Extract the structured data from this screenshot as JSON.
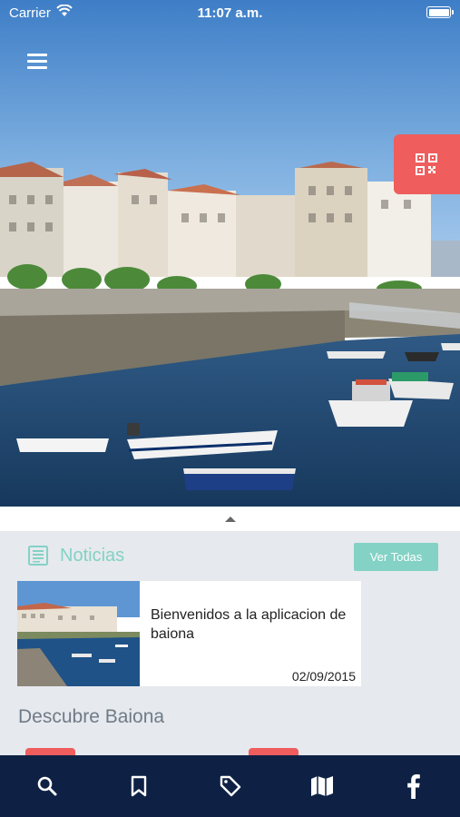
{
  "status_bar": {
    "carrier": "Carrier",
    "time": "11:07 a.m."
  },
  "hero": {
    "image": "harbor-waterfront-photo"
  },
  "icons": {
    "menu": "hamburger-menu-icon",
    "qr": "qr-code-icon",
    "news": "newspaper-icon",
    "collapse": "chevron-up-icon"
  },
  "news": {
    "section_title": "Noticias",
    "view_all_label": "Ver Todas",
    "items": [
      {
        "title": "Bienvenidos a la aplicacion de baiona",
        "date": "02/09/2015"
      }
    ]
  },
  "discover": {
    "title": "Descubre Baiona"
  },
  "bottom_nav": {
    "items": [
      "search-icon",
      "bookmark-icon",
      "tag-icon",
      "map-icon",
      "facebook-icon"
    ]
  },
  "colors": {
    "accent_teal": "#83d2c5",
    "accent_red": "#ef5d5d",
    "nav_background": "#0e2144",
    "content_background": "#e6e9ee"
  }
}
